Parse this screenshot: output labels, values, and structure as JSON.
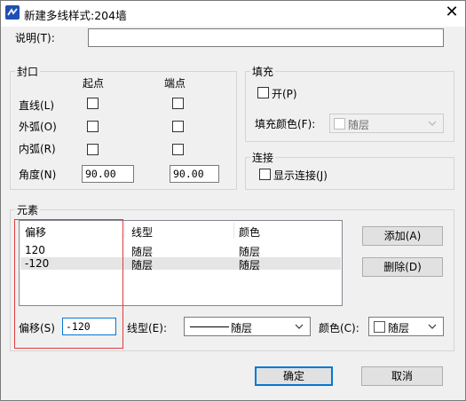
{
  "window": {
    "title": "新建多线样式:204墙",
    "close_glyph": "✕"
  },
  "description": {
    "label": "说明(T):",
    "value": ""
  },
  "caps": {
    "group_title": "封口",
    "start_header": "起点",
    "end_header": "端点",
    "line_label": "直线(L)",
    "outer_arc_label": "外弧(O)",
    "inner_arc_label": "内弧(R)",
    "angle_label": "角度(N)",
    "start_angle": "90.00",
    "end_angle": "90.00",
    "line_start_checked": false,
    "line_end_checked": false,
    "outer_arc_start_checked": false,
    "outer_arc_end_checked": false,
    "inner_arc_start_checked": false,
    "inner_arc_end_checked": false
  },
  "fill": {
    "group_title": "填充",
    "on_label": "开(P)",
    "on_checked": false,
    "color_label": "填充颜色(F):",
    "color_value": "随层"
  },
  "connections": {
    "group_title": "连接",
    "show_label": "显示连接(J)",
    "show_checked": false
  },
  "elements": {
    "group_title": "元素",
    "columns": [
      "偏移",
      "线型",
      "颜色"
    ],
    "rows": [
      {
        "offset": "120",
        "linetype": "随层",
        "color": "随层"
      },
      {
        "offset": "-120",
        "linetype": "随层",
        "color": "随层"
      }
    ],
    "selected_row": 1,
    "add_button": "添加(A)",
    "delete_button": "删除(D)",
    "offset_label": "偏移(S)",
    "offset_value": "-120",
    "linetype_label": "线型(E):",
    "linetype_value": "随层",
    "color_label": "颜色(C):",
    "color_value": "随层"
  },
  "footer": {
    "ok_button": "确定",
    "cancel_button": "取消"
  },
  "colors": {
    "highlight_frame": "#e03b3b",
    "default_button_border": "#0078d7",
    "dialog_bg": "#f0f0f0"
  }
}
